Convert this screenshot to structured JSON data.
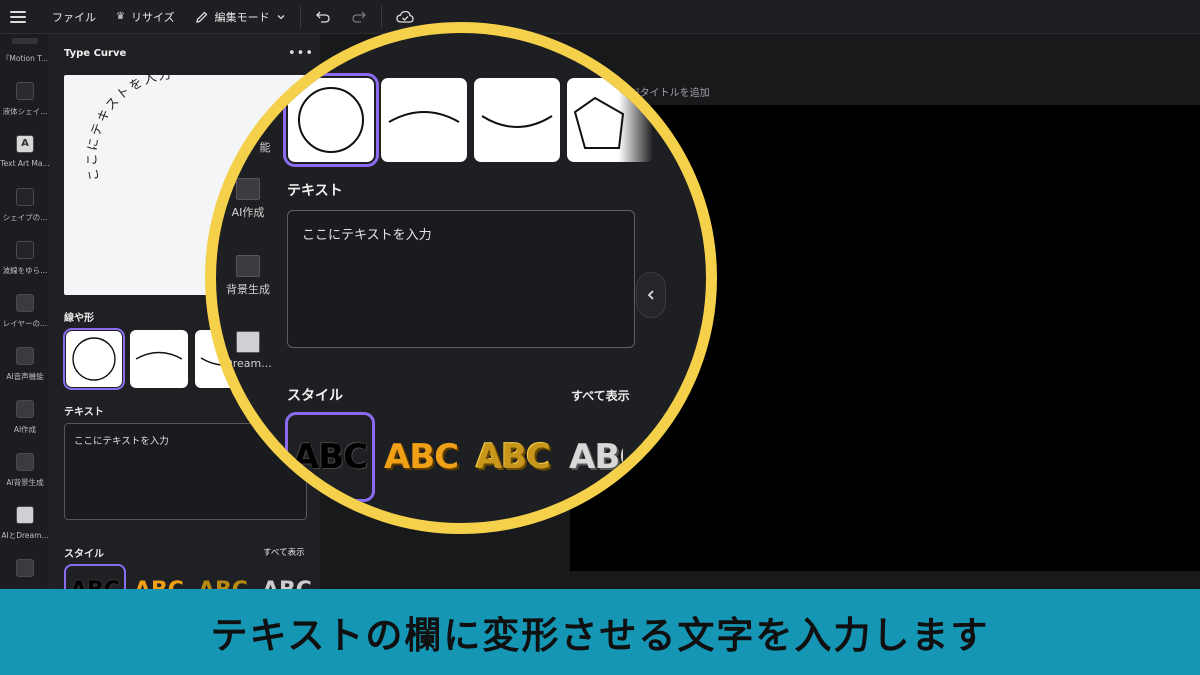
{
  "topbar": {
    "file": "ファイル",
    "resize": "リサイズ",
    "edit_mode": "編集モード"
  },
  "rail": [
    {
      "label": "『Motion T..."
    },
    {
      "label": "液体シェイ..."
    },
    {
      "label": "Text Art Ma..."
    },
    {
      "label": "シェイプの..."
    },
    {
      "label": "波線をゆら..."
    },
    {
      "label": "レイヤーの..."
    },
    {
      "label": "AI音声機能"
    },
    {
      "label": "AI作成"
    },
    {
      "label": "AI背景生成"
    },
    {
      "label": "AIとDream..."
    }
  ],
  "panel": {
    "title": "Type Curve",
    "more": "•••",
    "preview_text": "ここにテキストを入力",
    "shapes_label": "線や形",
    "text_label": "テキスト",
    "text_value": "ここにテキストを入力",
    "style_label": "スタイル",
    "show_all": "すべて表示"
  },
  "canvas": {
    "page_title_placeholder": "ージタイトルを追加"
  },
  "magnifier": {
    "rail": [
      {
        "label": "能"
      },
      {
        "label": "AI作成"
      },
      {
        "label": "背景生成"
      },
      {
        "label": "Dream..."
      }
    ],
    "text_label": "テキスト",
    "text_value": "ここにテキストを入力",
    "style_label": "スタイル",
    "show_all": "すべて表示",
    "style_sample": "ABC"
  },
  "caption": "テキストの欄に変形させる文字を入力します",
  "colors": {
    "accent": "#8b6cf0",
    "magnifier_ring": "#f4d04b",
    "caption_bg": "#1596b4",
    "style_orange": "#f0a017"
  }
}
